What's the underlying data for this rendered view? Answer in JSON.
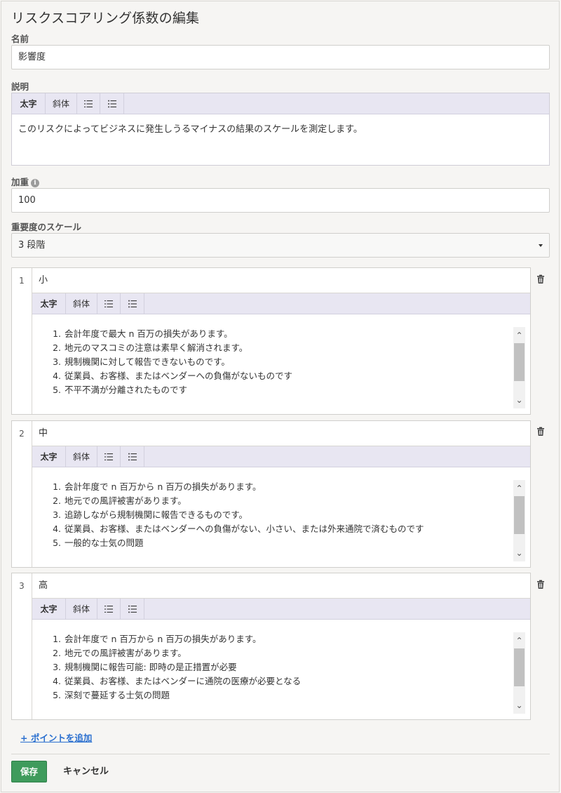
{
  "page": {
    "title": "リスクスコアリング係数の編集"
  },
  "name": {
    "label": "名前",
    "value": "影響度"
  },
  "description": {
    "label": "説明",
    "toolbar": {
      "bold": "太字",
      "italic": "斜体"
    },
    "text": "このリスクによってビジネスに発生しうるマイナスの結果のスケールを測定します。"
  },
  "weight": {
    "label": "加重",
    "value": "100"
  },
  "scale": {
    "label": "重要度のスケール",
    "selected": "3 段階"
  },
  "points": [
    {
      "number": "1",
      "name": "小",
      "toolbar": {
        "bold": "太字",
        "italic": "斜体"
      },
      "items": [
        "会計年度で最大 n 百万の損失があります。",
        "地元のマスコミの注意は素早く解消されます。",
        "規制機関に対して報告できないものです。",
        "従業員、お客様、またはベンダーへの負傷がないものです",
        "不平不満が分離されたものです"
      ]
    },
    {
      "number": "2",
      "name": "中",
      "toolbar": {
        "bold": "太字",
        "italic": "斜体"
      },
      "items": [
        "会計年度で n 百万から n 百万の損失があります。",
        "地元での風評被害があります。",
        "追跡しながら規制機関に報告できるものです。",
        "従業員、お客様、またはベンダーへの負傷がない、小さい、または外来通院で済むものです",
        "一般的な士気の問題"
      ]
    },
    {
      "number": "3",
      "name": "高",
      "toolbar": {
        "bold": "太字",
        "italic": "斜体"
      },
      "items": [
        "会計年度で n 百万から n 百万の損失があります。",
        "地元での風評被害があります。",
        "規制機関に報告可能: 即時の是正措置が必要",
        "従業員、お客様、またはベンダーに通院の医療が必要となる",
        "深刻で蔓延する士気の問題"
      ]
    }
  ],
  "actions": {
    "add_point": "+ ポイントを追加",
    "save": "保存",
    "cancel": "キャンセル"
  },
  "colors": {
    "save": "#3f9b5c",
    "link": "#2a6fcf",
    "toolbar": "#e8e6f2"
  }
}
